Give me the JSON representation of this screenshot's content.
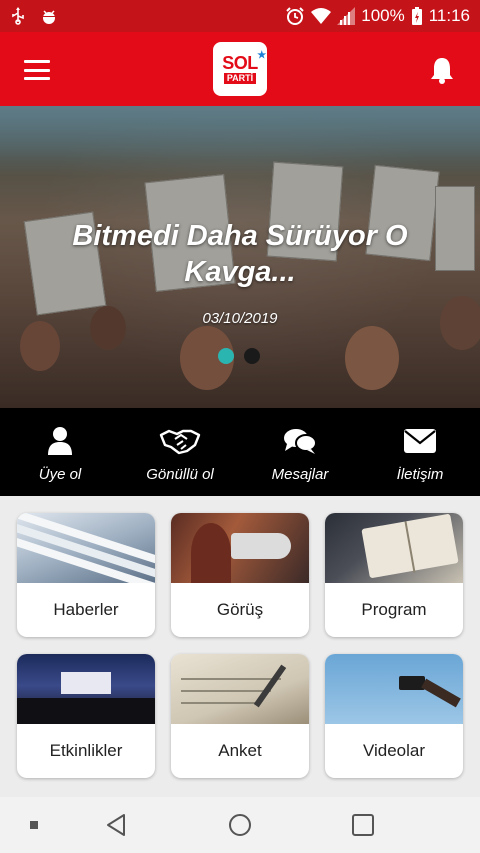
{
  "status_bar": {
    "battery": "100%",
    "time": "11:16",
    "icons": [
      "usb-icon",
      "android-debug-icon",
      "alarm-icon",
      "wifi-icon",
      "signal-icon",
      "battery-charging-icon"
    ]
  },
  "app_bar": {
    "logo_text": "SOL",
    "logo_subtext": "PARTİ",
    "menu_icon": "hamburger-icon",
    "notification_icon": "bell-icon"
  },
  "hero": {
    "title": "Bitmedi Daha Sürüyor O Kavga...",
    "date": "03/10/2019",
    "slides_total": 2,
    "active_slide": 1
  },
  "actions": [
    {
      "label": "Üye ol",
      "icon": "user-icon"
    },
    {
      "label": "Gönüllü ol",
      "icon": "handshake-icon"
    },
    {
      "label": "Mesajlar",
      "icon": "chat-bubbles-icon"
    },
    {
      "label": "İletişim",
      "icon": "envelope-icon"
    }
  ],
  "cards": [
    {
      "label": "Haberler",
      "image": "newspapers-photo"
    },
    {
      "label": "Görüş",
      "image": "megaphone-photo"
    },
    {
      "label": "Program",
      "image": "book-reading-photo"
    },
    {
      "label": "Etkinlikler",
      "image": "audience-event-photo"
    },
    {
      "label": "Anket",
      "image": "writing-notebook-photo"
    },
    {
      "label": "Videolar",
      "image": "video-camera-photo"
    }
  ],
  "colors": {
    "brand_red": "#e30b17",
    "status_red": "#c4141a",
    "accent_teal": "#2bb5b0",
    "action_bar_bg": "#000000"
  },
  "nav_bar": {
    "items": [
      "recent-dot-icon",
      "back-icon",
      "home-icon",
      "overview-icon"
    ]
  }
}
